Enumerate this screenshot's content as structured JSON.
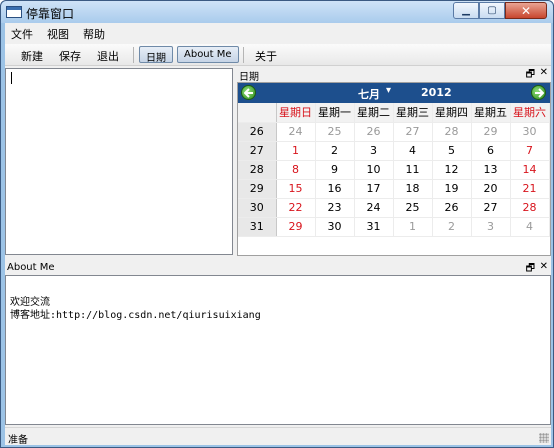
{
  "window": {
    "title": "停靠窗口"
  },
  "menubar": {
    "items": [
      "文件",
      "视图",
      "帮助"
    ]
  },
  "toolbar": {
    "new_label": "新建",
    "save_label": "保存",
    "exit_label": "退出",
    "date_toggle": "日期",
    "about_toggle": "About Me",
    "about_label": "关于"
  },
  "date_dock": {
    "title": "日期",
    "month": "七月",
    "year": "2012",
    "weekdays": [
      "星期日",
      "星期一",
      "星期二",
      "星期三",
      "星期四",
      "星期五",
      "星期六"
    ],
    "weeks": [
      {
        "num": "26",
        "days": [
          "24",
          "25",
          "26",
          "27",
          "28",
          "29",
          "30"
        ]
      },
      {
        "num": "27",
        "days": [
          "1",
          "2",
          "3",
          "4",
          "5",
          "6",
          "7"
        ]
      },
      {
        "num": "28",
        "days": [
          "8",
          "9",
          "10",
          "11",
          "12",
          "13",
          "14"
        ]
      },
      {
        "num": "29",
        "days": [
          "15",
          "16",
          "17",
          "18",
          "19",
          "20",
          "21"
        ]
      },
      {
        "num": "30",
        "days": [
          "22",
          "23",
          "24",
          "25",
          "26",
          "27",
          "28"
        ]
      },
      {
        "num": "31",
        "days": [
          "29",
          "30",
          "31",
          "1",
          "2",
          "3",
          "4"
        ]
      }
    ]
  },
  "about_dock": {
    "title": "About Me",
    "line1": "欢迎交流",
    "line2": "博客地址:http://blog.csdn.net/qiurisuixiang"
  },
  "status": {
    "text": "准备"
  },
  "colors": {
    "weekend": "#d8141c",
    "nav_bg": "#1d4f8d",
    "other_month": "#9a9a9a"
  }
}
